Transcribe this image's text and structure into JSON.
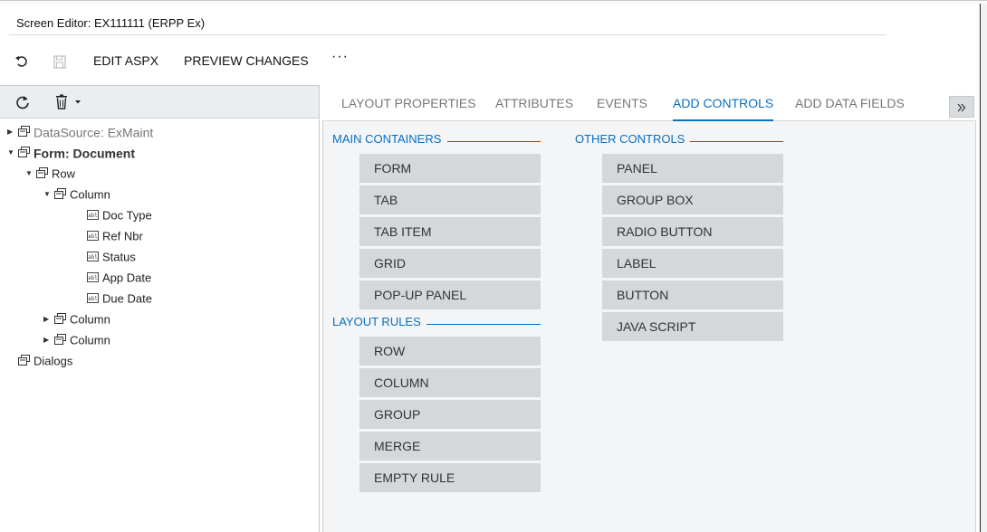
{
  "window": {
    "title": "Screen Editor: EX111111 (ERPP Ex)"
  },
  "toolbar": {
    "undo_icon": "undo-icon",
    "save_icon": "save-icon",
    "edit_aspx": "EDIT ASPX",
    "preview_changes": "PREVIEW CHANGES",
    "more": "···"
  },
  "tree_toolbar": {
    "refresh_icon": "refresh-icon",
    "delete_icon": "trash-icon"
  },
  "tree": [
    {
      "label": "DataSource: ExMaint",
      "level": 0,
      "expand": "collapsed",
      "style": "grey",
      "icon": "container-icon"
    },
    {
      "label": "Form: Document",
      "level": 0,
      "expand": "expanded",
      "style": "bold",
      "icon": "container-icon"
    },
    {
      "label": "Row",
      "level": 1,
      "expand": "expanded",
      "style": "normal",
      "icon": "container-icon"
    },
    {
      "label": "Column",
      "level": 2,
      "expand": "expanded",
      "style": "normal",
      "icon": "container-icon"
    },
    {
      "label": "Doc Type",
      "level": 3,
      "expand": "none",
      "style": "normal",
      "icon": "field-icon"
    },
    {
      "label": "Ref Nbr",
      "level": 3,
      "expand": "none",
      "style": "normal",
      "icon": "field-icon"
    },
    {
      "label": "Status",
      "level": 3,
      "expand": "none",
      "style": "normal",
      "icon": "field-icon"
    },
    {
      "label": "App Date",
      "level": 3,
      "expand": "none",
      "style": "normal",
      "icon": "field-icon"
    },
    {
      "label": "Due Date",
      "level": 3,
      "expand": "none",
      "style": "normal",
      "icon": "field-icon"
    },
    {
      "label": "Column",
      "level": 2,
      "expand": "collapsed",
      "style": "normal",
      "icon": "container-icon"
    },
    {
      "label": "Column",
      "level": 2,
      "expand": "collapsed",
      "style": "normal",
      "icon": "container-icon"
    },
    {
      "label": "Dialogs",
      "level": 0,
      "expand": "none",
      "style": "normal",
      "icon": "container-icon"
    }
  ],
  "tabs": [
    {
      "label": "LAYOUT PROPERTIES",
      "active": false
    },
    {
      "label": "ATTRIBUTES",
      "active": false
    },
    {
      "label": "EVENTS",
      "active": false
    },
    {
      "label": "ADD CONTROLS",
      "active": true
    },
    {
      "label": "ADD DATA FIELDS",
      "active": false
    }
  ],
  "tab_scroll_icon": "double-chevron-right-icon",
  "sections": {
    "main_containers": {
      "title": "MAIN CONTAINERS",
      "items": [
        "FORM",
        "TAB",
        "TAB ITEM",
        "GRID",
        "POP-UP PANEL"
      ]
    },
    "layout_rules": {
      "title": "LAYOUT RULES",
      "items": [
        "ROW",
        "COLUMN",
        "GROUP",
        "MERGE",
        "EMPTY RULE"
      ]
    },
    "other_controls": {
      "title": "OTHER CONTROLS",
      "items": [
        "PANEL",
        "GROUP BOX",
        "RADIO BUTTON",
        "LABEL",
        "BUTTON",
        "JAVA SCRIPT"
      ]
    }
  },
  "colors": {
    "accent": "#0a6fc0",
    "button_bg": "#d4d8db",
    "panel_bg": "#f3f5f6"
  }
}
